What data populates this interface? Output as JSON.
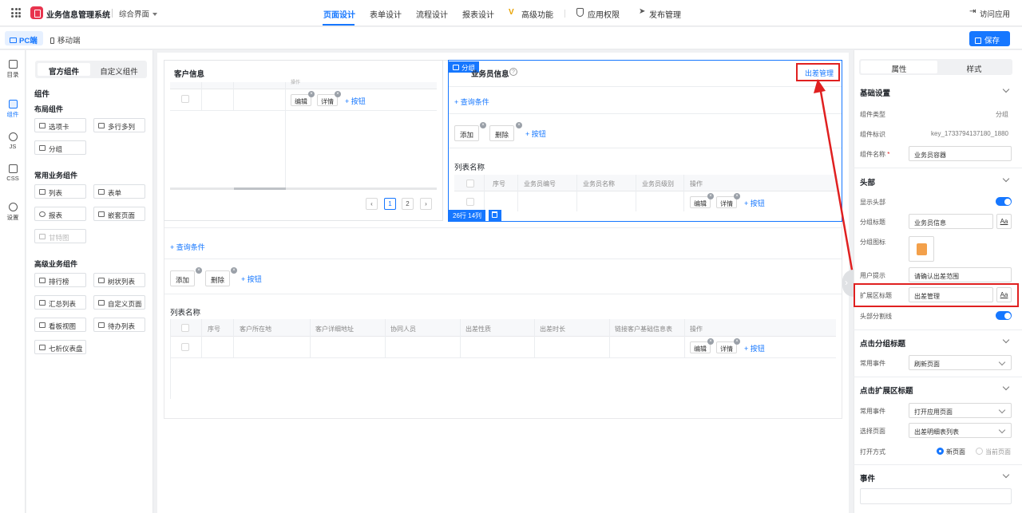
{
  "topbar": {
    "app_title": "业务信息管理系统",
    "page_name": "综合界面",
    "tabs": [
      "页面设计",
      "表单设计",
      "流程设计",
      "报表设计",
      "高级功能",
      "应用权限",
      "发布管理"
    ],
    "visit": "访问应用"
  },
  "subbar": {
    "pc": "PC端",
    "mobile": "移动端",
    "save": "保存"
  },
  "rail": [
    {
      "label": "目录",
      "icon": "directory-icon"
    },
    {
      "label": "组件",
      "icon": "components-icon"
    },
    {
      "label": "JS",
      "icon": "js-icon"
    },
    {
      "label": "CSS",
      "icon": "css-icon"
    },
    {
      "label": "设置",
      "icon": "settings-icon"
    }
  ],
  "components": {
    "tabs": [
      "官方组件",
      "自定义组件"
    ],
    "heading": "组件",
    "layout_title": "布局组件",
    "layout": [
      "选项卡",
      "多行多列",
      "分组"
    ],
    "common_title": "常用业务组件",
    "common": [
      "列表",
      "表单",
      "报表",
      "嵌套页面",
      "甘特图"
    ],
    "advanced_title": "高级业务组件",
    "advanced": [
      "排行榜",
      "树状列表",
      "汇总列表",
      "自定义页面",
      "看板视图",
      "待办列表",
      "七析仪表盘"
    ]
  },
  "canvas": {
    "customer": {
      "title": "客户信息",
      "ops_header": "操作",
      "edit": "编辑",
      "detail": "详情",
      "add_button": "+ 按钮",
      "pages": [
        "1",
        "2"
      ]
    },
    "sales": {
      "badge": "分组",
      "title": "业务员信息",
      "ext_title": "出差管理",
      "query": "+ 查询条件",
      "add": "添加",
      "delete": "删除",
      "add_button": "+ 按钮",
      "list_name": "列表名称",
      "headers": [
        "序号",
        "业务员编号",
        "业务员名称",
        "业务员级别",
        "操作"
      ],
      "edit": "编辑",
      "detail": "详情",
      "stats": "26行 14列"
    },
    "main": {
      "query": "+ 查询条件",
      "add": "添加",
      "delete": "删除",
      "add_button": "+ 按钮",
      "list_name": "列表名称",
      "headers": [
        "序号",
        "客户所在地",
        "客户详细地址",
        "协同人员",
        "出差性质",
        "出差时长",
        "链接客户基础信息表",
        "操作"
      ],
      "edit": "编辑",
      "detail": "详情"
    }
  },
  "props": {
    "tabs": [
      "属性",
      "样式"
    ],
    "basic_title": "基础设置",
    "type_label": "组件类型",
    "type_value": "分组",
    "key_label": "组件标识",
    "key_value": "key_1733794137180_1880",
    "name_label": "组件名称",
    "name_value": "业务员容器",
    "header_title": "头部",
    "show_header": "显示头部",
    "group_title_label": "分组标题",
    "group_title_value": "业务员信息",
    "group_icon_label": "分组图标",
    "hint_label": "用户提示",
    "hint_value": "请确认出差范围",
    "ext_label": "扩展区标题",
    "ext_value": "出差管理",
    "divider_label": "头部分割线",
    "aa": "Aa",
    "click_group_title": "点击分组标题",
    "event_label": "常用事件",
    "event_value_1": "刷新页面",
    "click_ext_title": "点击扩展区标题",
    "event_value_2": "打开应用页面",
    "select_page_label": "选择页面",
    "select_page_value": "出差明细表列表",
    "open_mode_label": "打开方式",
    "open_new": "新页面",
    "open_current": "当前页面",
    "events_title": "事件",
    "colors": {
      "accent": "#1677ff",
      "highlight": "#e02020"
    }
  }
}
